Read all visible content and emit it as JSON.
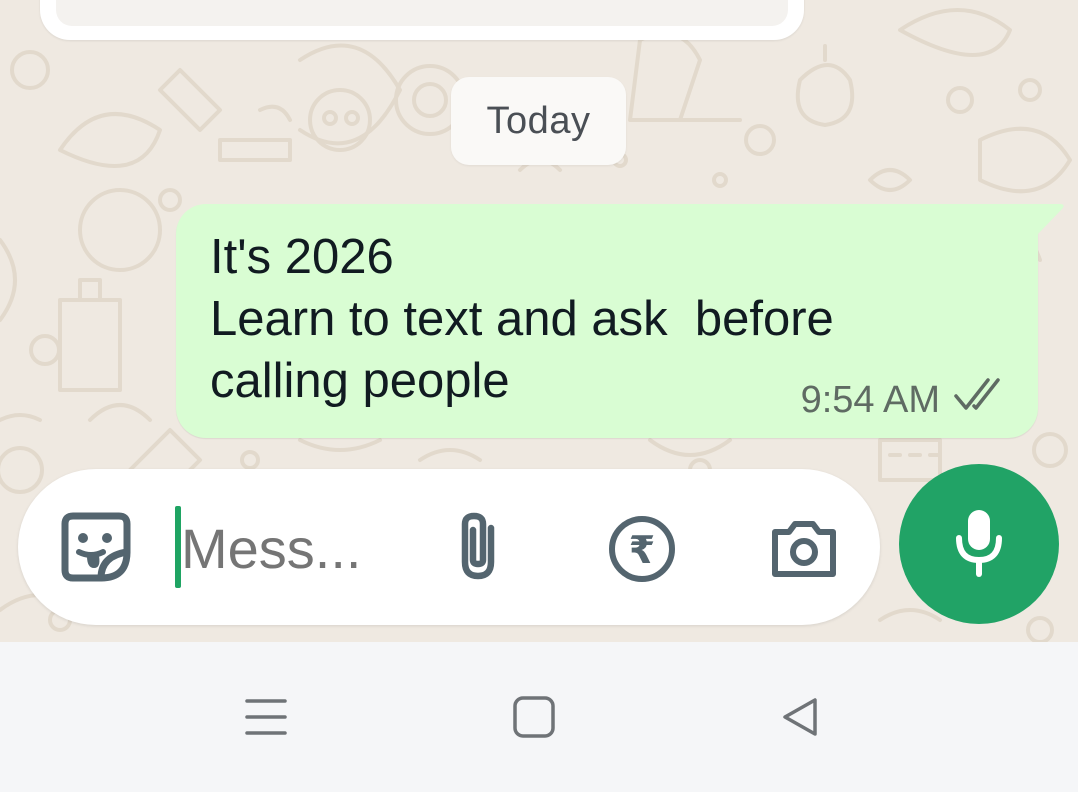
{
  "date_separator": "Today",
  "message": {
    "text": "It's 2026\nLearn to text and ask  before\ncalling people",
    "time": "9:54 AM",
    "status_icon": "double-check-icon"
  },
  "composer": {
    "placeholder": "Mess...",
    "icons": [
      "sticker-icon",
      "attach-icon",
      "rupee-payment-icon",
      "camera-icon"
    ],
    "send_icon": "mic-icon"
  },
  "navigation_bar": {
    "icons": [
      "menu-icon",
      "home-icon",
      "back-icon"
    ]
  },
  "colors": {
    "chat_background": "#efe9e1",
    "outgoing_bubble": "#d9fdd3",
    "accent_green": "#21a366",
    "icon_gray": "#54656f",
    "nav_bar": "#f5f6f8"
  }
}
